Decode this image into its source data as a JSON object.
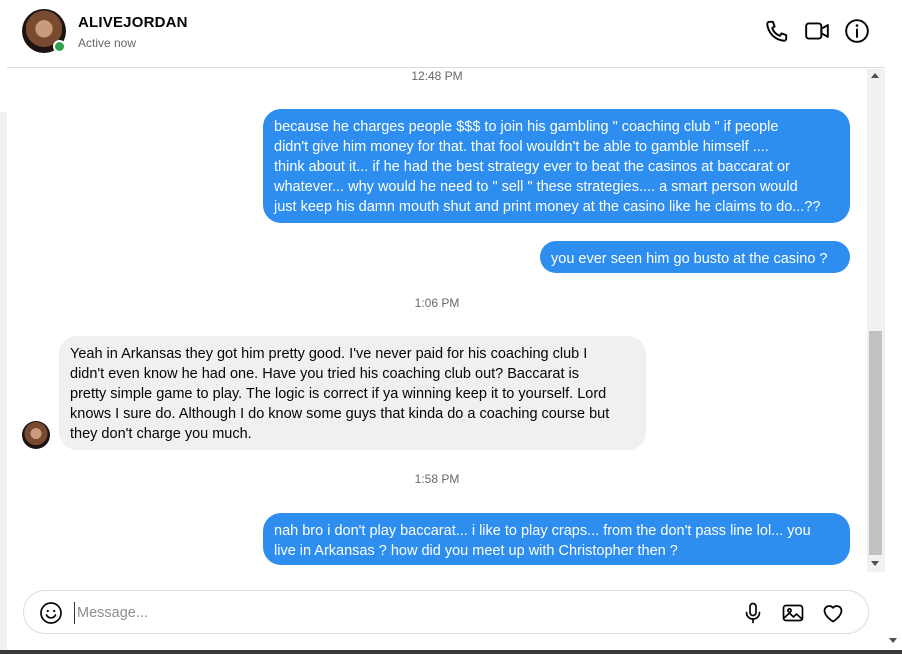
{
  "contact": {
    "name": "ALIVEJORDAN",
    "status": "Active now"
  },
  "header_icons": [
    "phone-icon",
    "video-icon",
    "info-icon"
  ],
  "timestamps": [
    "12:48 PM",
    "1:06 PM",
    "1:58 PM"
  ],
  "messages": [
    {
      "direction": "outgoing",
      "text": "because he charges people $$$  to join his gambling \" coaching club \" if people\ndidn't give him money for that.   that  fool wouldn't be able to gamble himself ....\nthink about it... if he had the best strategy ever to beat the casinos at baccarat or\nwhatever... why would he need to \" sell \" these strategies....  a smart person would\njust keep his damn mouth shut and print money at the casino like he claims to do...??"
    },
    {
      "direction": "outgoing",
      "text": "you ever seen him go busto  at the casino ?"
    },
    {
      "direction": "incoming",
      "text": "Yeah in Arkansas they got him pretty good. I've never paid for his coaching club I\ndidn't even know he had one. Have you tried his coaching club out? Baccarat is\npretty simple game to play. The logic is correct if ya winning keep it to yourself. Lord\nknows I sure do. Although I do know some guys that kinda do a coaching course but\nthey don't charge you much."
    },
    {
      "direction": "outgoing",
      "text": "nah bro i don't play baccarat... i like to play craps... from the don't pass line  lol... you\nlive in Arkansas ?  how did you meet up with Christopher then ?"
    }
  ],
  "composer": {
    "placeholder": "Message...",
    "value": ""
  },
  "colors": {
    "outgoing_bubble": "#2d8ef0",
    "incoming_bubble": "#f0f0f0",
    "online_dot": "#31a24c"
  }
}
